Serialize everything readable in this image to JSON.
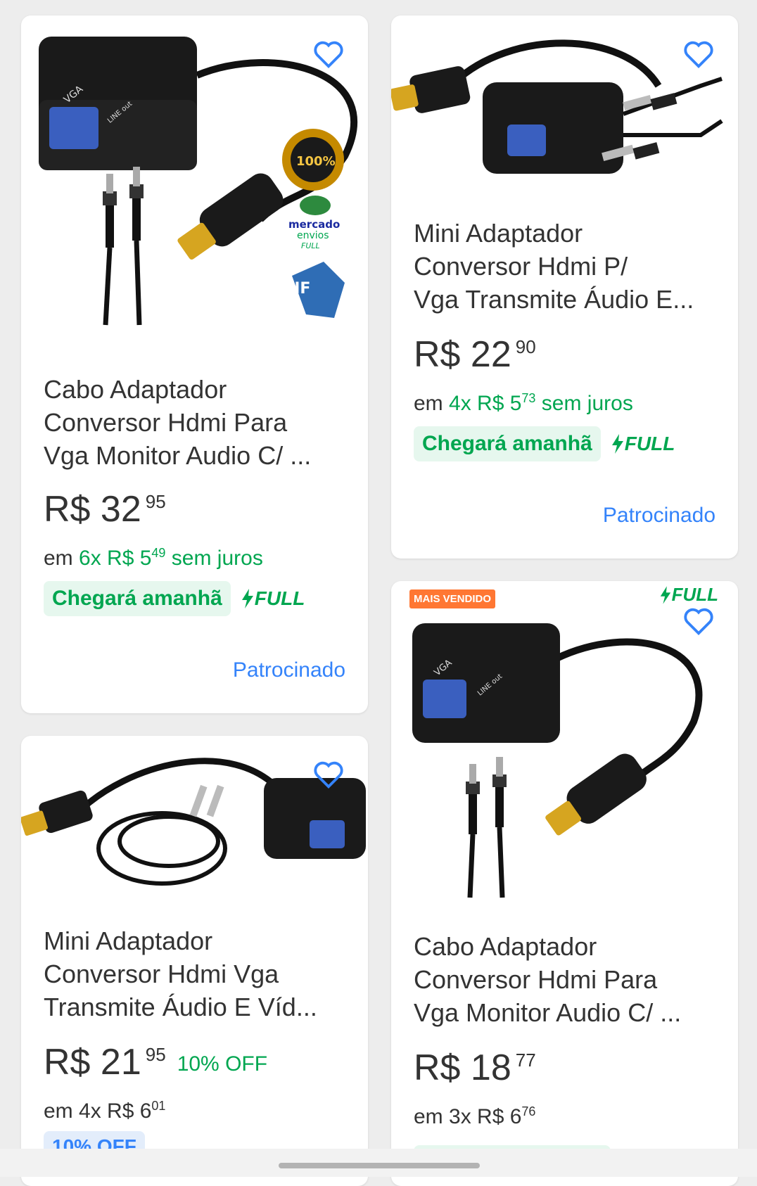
{
  "products": [
    {
      "title": "Cabo Adaptador\nConversor Hdmi Para\nVga Monitor Audio C/ ...",
      "price_int": "R$ 32",
      "price_cents": "95",
      "installments_prefix": "em",
      "installments_count": "6x R$ 5",
      "installments_cents": "49",
      "installments_suffix": "sem juros",
      "shipping": "Chegará amanhã",
      "full": "FULL",
      "sponsored": "Patrocinado",
      "image_labels": {
        "vga": "VGA",
        "line": "LINE out",
        "seal": "100%",
        "me1": "mercado",
        "me2": "envios",
        "me3": "FULL",
        "nfe": "NF"
      }
    },
    {
      "title": "Mini Adaptador\nConversor Hdmi P/\nVga Transmite Áudio E...",
      "price_int": "R$ 22",
      "price_cents": "90",
      "installments_prefix": "em",
      "installments_count": "4x R$ 5",
      "installments_cents": "73",
      "installments_suffix": "sem juros",
      "shipping": "Chegará amanhã",
      "full": "FULL",
      "sponsored": "Patrocinado"
    },
    {
      "title": "Mini Adaptador\nConversor Hdmi Vga\nTransmite Áudio E Víd...",
      "price_int": "R$ 21",
      "price_cents": "95",
      "discount": "10% OFF",
      "installments_text": "em 4x R$ 6",
      "installments_cents": "01",
      "promo_pill": "10% OFF"
    },
    {
      "badge": "MAIS VENDIDO",
      "full": "FULL",
      "title": "Cabo Adaptador\nConversor Hdmi Para\nVga Monitor Audio C/ ...",
      "price_int": "R$ 18",
      "price_cents": "77",
      "installments_text": "em 3x R$ 6",
      "installments_cents": "76",
      "image_labels": {
        "vga": "VGA",
        "line": "LINE out"
      }
    }
  ],
  "colors": {
    "green": "#00a650",
    "blue": "#3483fa",
    "orange": "#ff7733"
  }
}
